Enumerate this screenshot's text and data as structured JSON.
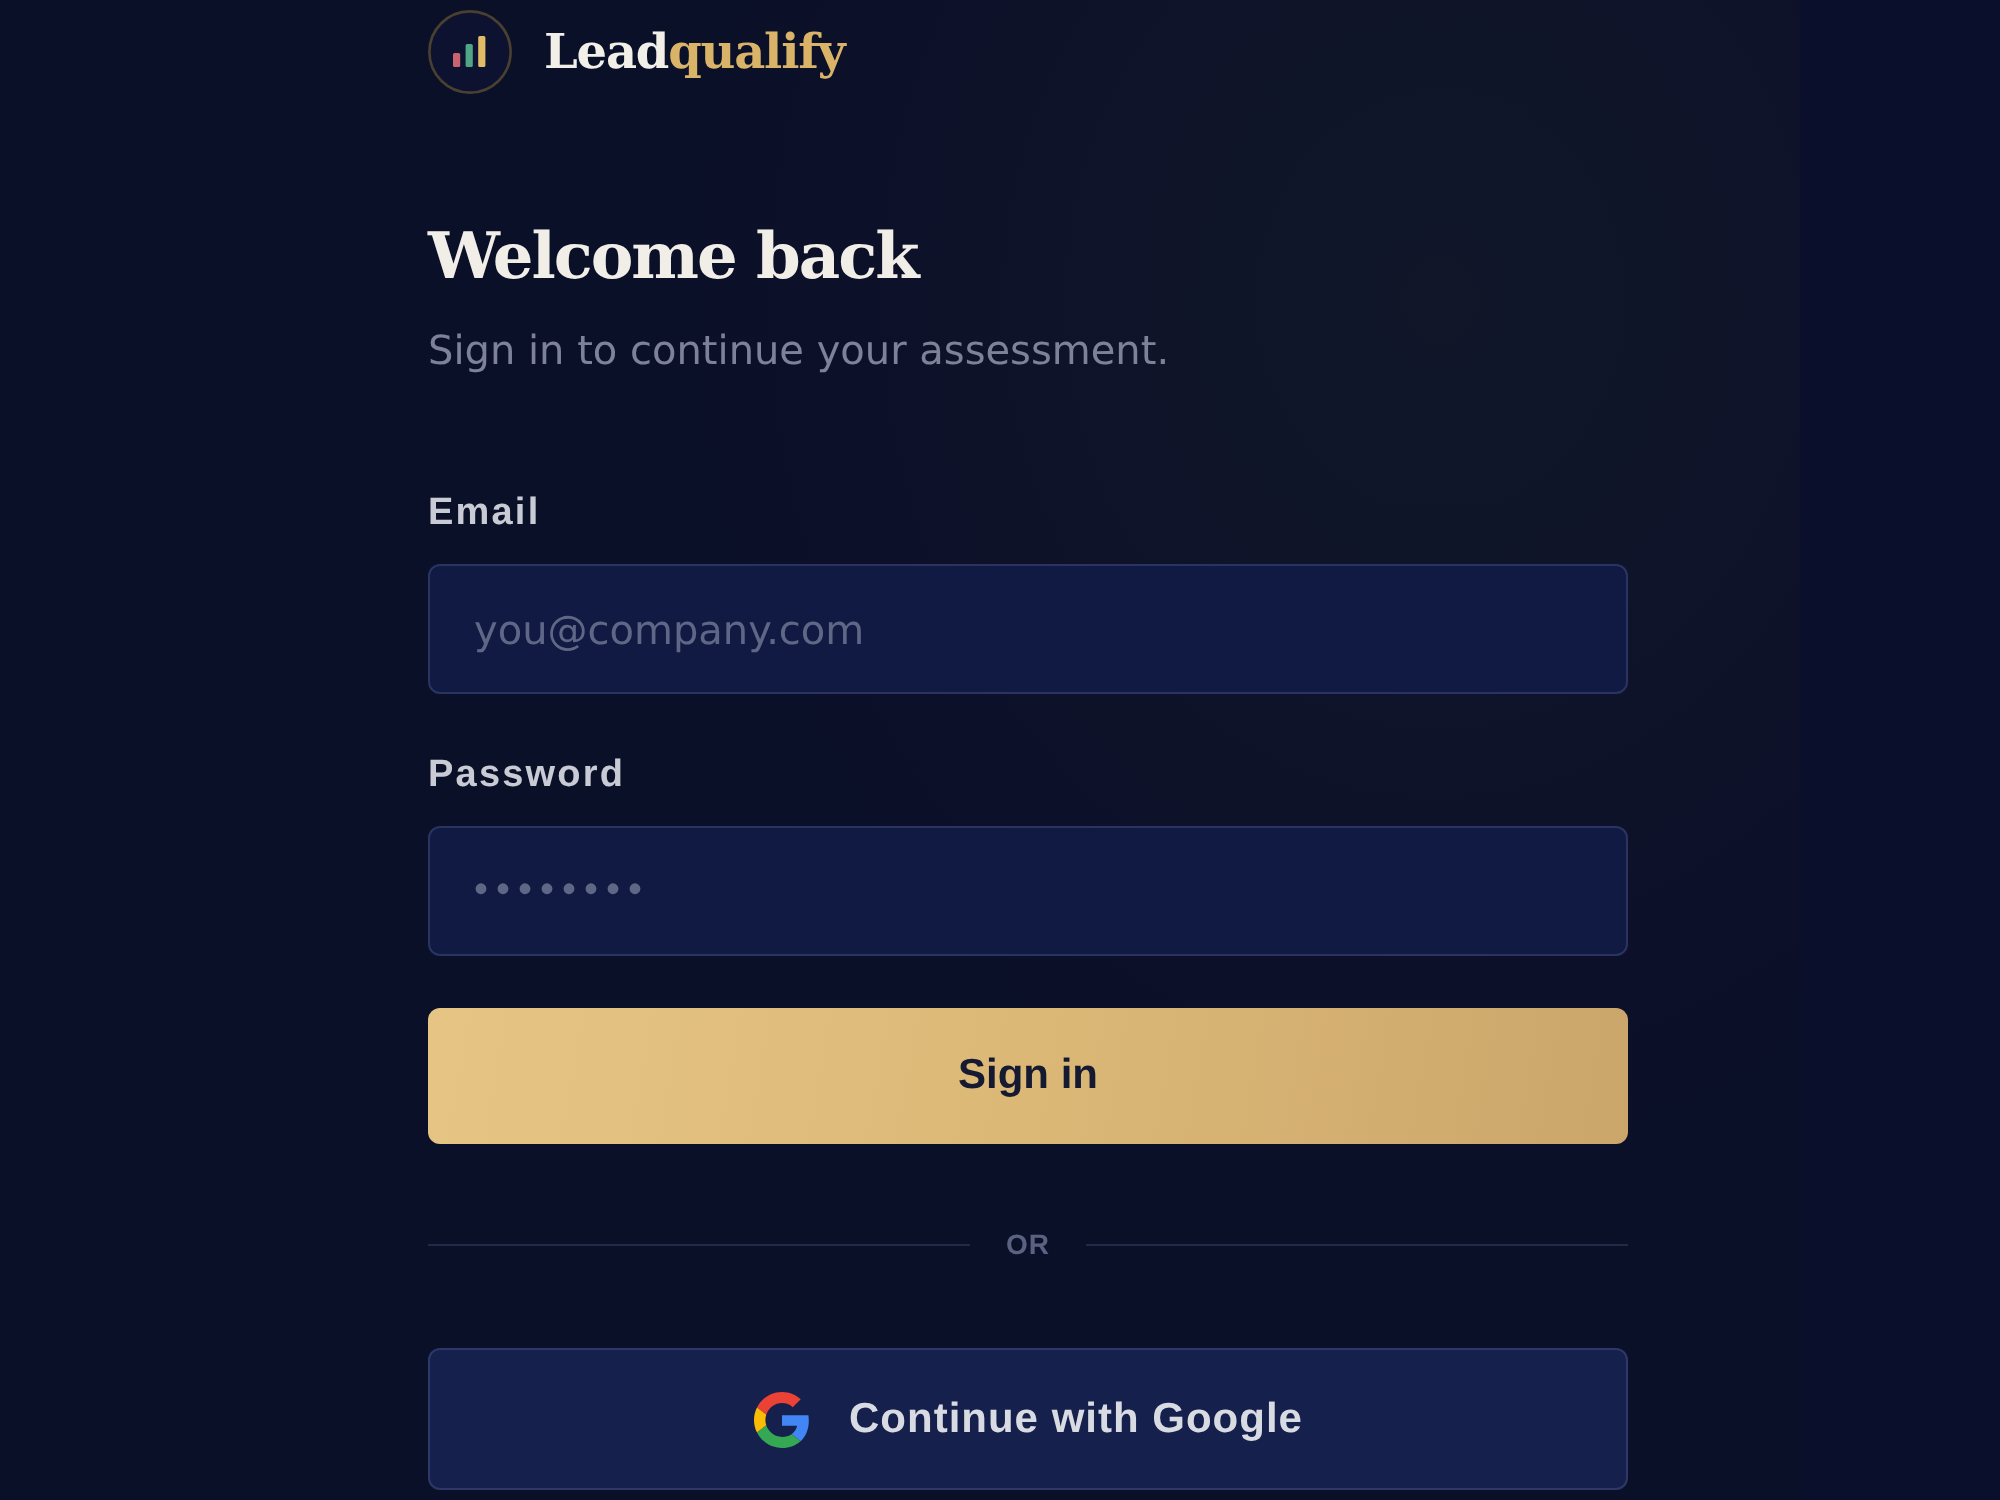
{
  "brand": {
    "name": "Lead",
    "name_accent": "qualify"
  },
  "heading": {
    "title": "Welcome back",
    "subtitle": "Sign in to continue your assessment."
  },
  "fields": [
    {
      "kind": "email",
      "label": "Email",
      "placeholder": "you@company.com"
    },
    {
      "kind": "password",
      "label": "Password",
      "placeholder": "••••••••"
    }
  ],
  "submit": {
    "label": "Sign in"
  },
  "divider": {
    "label": "OR"
  },
  "oauth": [
    {
      "kind": "google",
      "label": "Continue with Google"
    }
  ]
}
